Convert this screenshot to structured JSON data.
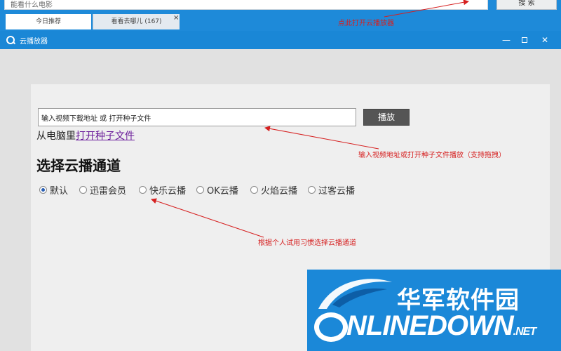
{
  "topbar": {
    "search_value": "能看什么电影",
    "search_button": "搜 索",
    "tabs": [
      {
        "label": "今日推荐"
      },
      {
        "label": "看看去哪儿 (167)"
      }
    ],
    "tab_close": "×"
  },
  "window": {
    "title": "云播放器",
    "minimize": "—",
    "close": "✕"
  },
  "panel": {
    "url_value": "输入视频下载地址 或 打开种子文件",
    "play_button": "播放",
    "local_prefix": "从电脑里",
    "local_link": "打开种子文件",
    "channel_heading": "选择云播通道",
    "channels": [
      {
        "label": "默认",
        "selected": true
      },
      {
        "label": "迅雷会员",
        "selected": false
      },
      {
        "label": "快乐云播",
        "selected": false
      },
      {
        "label": "OK云播",
        "selected": false
      },
      {
        "label": "火焰云播",
        "selected": false
      },
      {
        "label": "过客云播",
        "selected": false
      }
    ]
  },
  "annotations": {
    "open_player": "点此打开云播放器",
    "input_tip": "输入视频地址或打开种子文件播放（支持拖拽）",
    "channel_tip": "根据个人试用习惯选择云播通道",
    "color": "#d62020"
  },
  "watermark": {
    "cn": "华军软件园",
    "en_rest": "NLINEDOWN",
    "net": ".NET",
    "accent": "#1b88d8"
  },
  "colors": {
    "titlebar": "#1a87d6",
    "panel": "#efefef",
    "play_button": "#555555",
    "link": "#6a1b9a"
  }
}
